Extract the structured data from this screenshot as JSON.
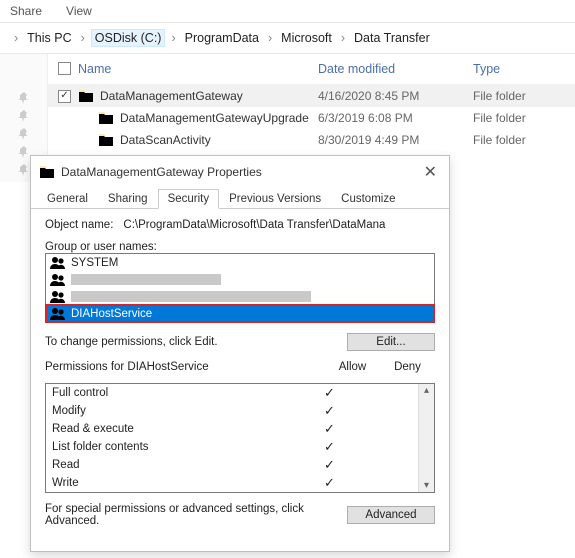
{
  "menubar": {
    "share": "Share",
    "view": "View"
  },
  "breadcrumb": {
    "segs": [
      "This PC",
      "OSDisk (C:)",
      "ProgramData",
      "Microsoft",
      "Data Transfer"
    ]
  },
  "file_header": {
    "name": "Name",
    "date": "Date modified",
    "type": "Type"
  },
  "files": [
    {
      "checked": true,
      "name": "DataManagementGateway",
      "date": "4/16/2020 8:45 PM",
      "type": "File folder",
      "selected": true
    },
    {
      "checked": false,
      "name": "DataManagementGatewayUpgrade",
      "date": "6/3/2019 6:08 PM",
      "type": "File folder",
      "selected": false
    },
    {
      "checked": false,
      "name": "DataScanActivity",
      "date": "8/30/2019 4:49 PM",
      "type": "File folder",
      "selected": false
    }
  ],
  "dialog": {
    "title": "DataManagementGateway Properties",
    "tabs": [
      "General",
      "Sharing",
      "Security",
      "Previous Versions",
      "Customize"
    ],
    "active_tab": "Security",
    "object_label": "Object name:",
    "object_value": "C:\\ProgramData\\Microsoft\\Data Transfer\\DataMana",
    "group_label": "Group or user names:",
    "principals": {
      "system": "SYSTEM",
      "diahost": "DIAHostService"
    },
    "edit_hint": "To change permissions, click Edit.",
    "edit_btn": "Edit...",
    "perm_label": "Permissions for DIAHostService",
    "allow": "Allow",
    "deny": "Deny",
    "perms": [
      {
        "name": "Full control",
        "allow": true,
        "deny": false
      },
      {
        "name": "Modify",
        "allow": true,
        "deny": false
      },
      {
        "name": "Read & execute",
        "allow": true,
        "deny": false
      },
      {
        "name": "List folder contents",
        "allow": true,
        "deny": false
      },
      {
        "name": "Read",
        "allow": true,
        "deny": false
      },
      {
        "name": "Write",
        "allow": true,
        "deny": false
      }
    ],
    "adv_hint": "For special permissions or advanced settings, click Advanced.",
    "adv_btn": "Advanced"
  }
}
